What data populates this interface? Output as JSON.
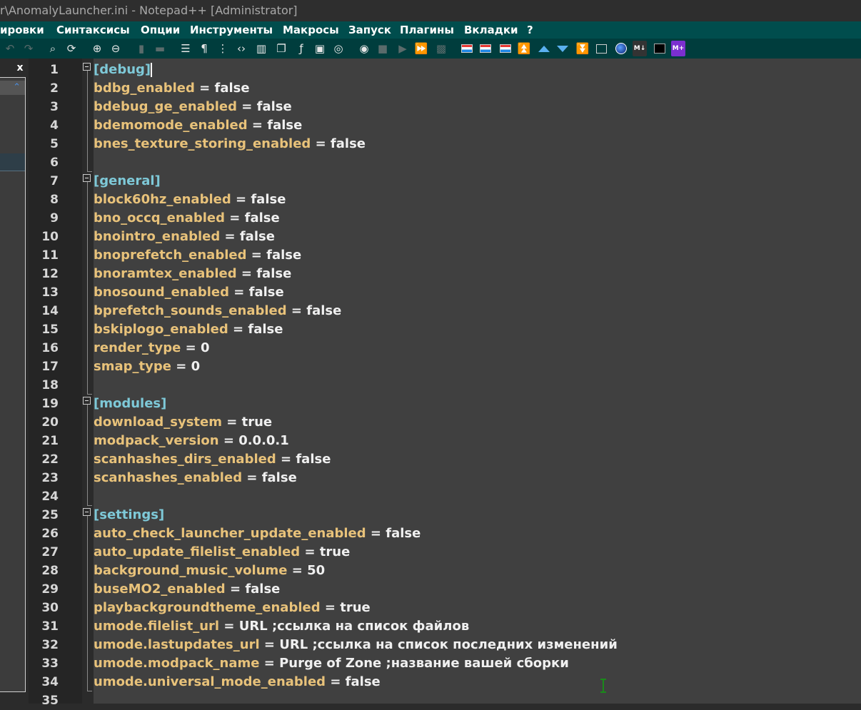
{
  "window": {
    "title": "r\\AnomalyLauncher.ini - Notepad++ [Administrator]"
  },
  "menu": {
    "items": [
      "ировки",
      "Синтаксисы",
      "Опции",
      "Инструменты",
      "Макросы",
      "Запуск",
      "Плагины",
      "Вкладки",
      "?"
    ]
  },
  "toolbar": {
    "icons": [
      "undo-icon",
      "redo-icon",
      "find-icon",
      "replace-icon",
      "zoom-in-icon",
      "zoom-out-icon",
      "sync-vertical-icon",
      "sync-horizontal-icon",
      "word-wrap-icon",
      "show-all-chars-icon",
      "indent-guide-icon",
      "xml-tag-icon",
      "document-map-icon",
      "document-list-icon",
      "function-list-icon",
      "monitoring-icon",
      "focus-icon",
      "record-macro-icon",
      "stop-macro-icon",
      "play-macro-icon",
      "run-macro-multiple-icon",
      "save-macro-icon",
      "compare-icon",
      "diff-icon",
      "diff-clear-icon",
      "first-diff-icon",
      "prev-diff-icon",
      "next-diff-icon",
      "last-diff-icon",
      "panel-icon",
      "globe-icon",
      "markdown-icon",
      "terminal-icon",
      "markdown-plus-icon"
    ]
  },
  "panel": {
    "close_label": "x"
  },
  "editor": {
    "lines": [
      {
        "n": "1",
        "type": "section",
        "text": "[debug]",
        "cursor": true
      },
      {
        "n": "2",
        "type": "kv",
        "key": "bdbg_enabled",
        "value": "false"
      },
      {
        "n": "3",
        "type": "kv",
        "key": "bdebug_ge_enabled",
        "value": "false"
      },
      {
        "n": "4",
        "type": "kv",
        "key": "bdemomode_enabled",
        "value": "false"
      },
      {
        "n": "5",
        "type": "kv",
        "key": "bnes_texture_storing_enabled",
        "value": "false"
      },
      {
        "n": "6",
        "type": "blank"
      },
      {
        "n": "7",
        "type": "section",
        "text": "[general]"
      },
      {
        "n": "8",
        "type": "kv",
        "key": "block60hz_enabled",
        "value": "false"
      },
      {
        "n": "9",
        "type": "kv",
        "key": "bno_occq_enabled",
        "value": "false"
      },
      {
        "n": "10",
        "type": "kv",
        "key": "bnointro_enabled",
        "value": "false"
      },
      {
        "n": "11",
        "type": "kv",
        "key": "bnoprefetch_enabled",
        "value": "false"
      },
      {
        "n": "12",
        "type": "kv",
        "key": "bnoramtex_enabled",
        "value": "false"
      },
      {
        "n": "13",
        "type": "kv",
        "key": "bnosound_enabled",
        "value": "false"
      },
      {
        "n": "14",
        "type": "kv",
        "key": "bprefetch_sounds_enabled",
        "value": "false"
      },
      {
        "n": "15",
        "type": "kv",
        "key": "bskiplogo_enabled",
        "value": "false"
      },
      {
        "n": "16",
        "type": "kv",
        "key": "render_type",
        "value": "0"
      },
      {
        "n": "17",
        "type": "kv",
        "key": "smap_type",
        "value": "0"
      },
      {
        "n": "18",
        "type": "blank"
      },
      {
        "n": "19",
        "type": "section",
        "text": "[modules]"
      },
      {
        "n": "20",
        "type": "kv",
        "key": "download_system",
        "value": "true"
      },
      {
        "n": "21",
        "type": "kv",
        "key": "modpack_version",
        "value": "0.0.0.1"
      },
      {
        "n": "22",
        "type": "kv",
        "key": "scanhashes_dirs_enabled",
        "value": "false"
      },
      {
        "n": "23",
        "type": "kv",
        "key": "scanhashes_enabled",
        "value": "false"
      },
      {
        "n": "24",
        "type": "blank"
      },
      {
        "n": "25",
        "type": "section",
        "text": "[settings]"
      },
      {
        "n": "26",
        "type": "kv",
        "key": "auto_check_launcher_update_enabled",
        "value": "false"
      },
      {
        "n": "27",
        "type": "kv",
        "key": "auto_update_filelist_enabled",
        "value": "true"
      },
      {
        "n": "28",
        "type": "kv",
        "key": "background_music_volume",
        "value": "50"
      },
      {
        "n": "29",
        "type": "kv",
        "key": "buseMO2_enabled",
        "value": "false"
      },
      {
        "n": "30",
        "type": "kv",
        "key": "playbackgroundtheme_enabled",
        "value": "true"
      },
      {
        "n": "31",
        "type": "kv",
        "key": "umode.filelist_url",
        "value": "URL ;ссылка на список файлов"
      },
      {
        "n": "32",
        "type": "kv",
        "key": "umode.lastupdates_url",
        "value": "URL ;ссылка на список последних изменений"
      },
      {
        "n": "33",
        "type": "kv",
        "key": "umode.modpack_name",
        "value": "Purge of Zone ;название вашей сборки"
      },
      {
        "n": "34",
        "type": "kv",
        "key": "umode.universal_mode_enabled",
        "value": "false"
      },
      {
        "n": "35",
        "type": "blank"
      }
    ]
  },
  "colors": {
    "menubar": "#004d4d",
    "toolbar": "#003d3d",
    "section": "#7ec9d8",
    "key": "#e8c27a",
    "value": "#f0f0f0"
  }
}
